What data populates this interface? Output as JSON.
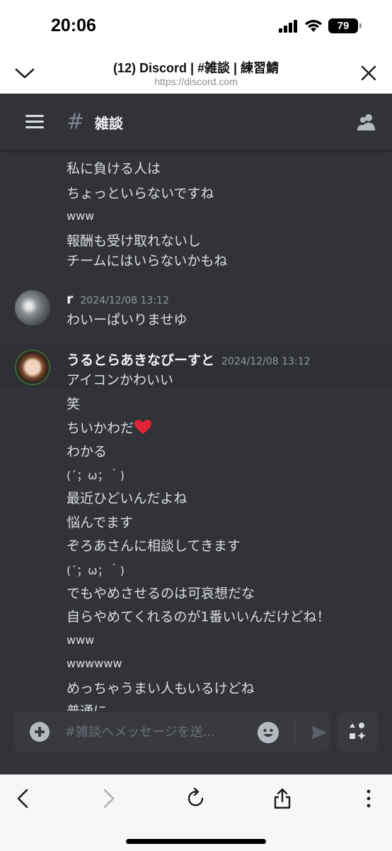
{
  "status_bar": {
    "time": "20:06",
    "battery": "79"
  },
  "sheet": {
    "title": "(12) Discord | #雑談 | 練習鯖",
    "url": "https://discord.com"
  },
  "channel": {
    "hash": "#",
    "name": "雑談"
  },
  "messages": {
    "continuation_top": [
      "私に負ける人は",
      "ちょっといらないですね",
      "www",
      "報酬も受け取れないし",
      "チームにはいらないかもね"
    ],
    "group_r": {
      "username": "r",
      "timestamp": "2024/12/08 13:12",
      "lines": [
        "わいーぱいりませゆ"
      ]
    },
    "group_uru": {
      "username": "うるとらあきなびーすと",
      "timestamp": "2024/12/08 13:12",
      "lines": [
        "アイコンかわいい",
        "笑",
        "ちいかわだ",
        "わかる",
        "(´；ω；｀)",
        "最近ひどいんだよね",
        "悩んでます",
        "ぞろあさんに相談してきます",
        "(´；ω；｀)",
        "でもやめさせるのは可哀想だな",
        "自らやめてくれるのが1番いいんだけどね！",
        "www",
        "wwwwww",
        "めっちゃうまい人もいるけどね",
        "普通に"
      ],
      "heart_emoji": "❤️"
    }
  },
  "composer": {
    "placeholder": "#雑談へメッセージを送..."
  },
  "icons": {
    "chevron": "chevron-down-icon",
    "close": "close-icon",
    "menu": "hamburger-menu-icon",
    "members": "members-icon",
    "add": "plus-circle-icon",
    "emoji": "emoji-icon",
    "send": "send-icon",
    "apps": "apps-icon",
    "back": "back-arrow-icon",
    "forward": "forward-arrow-icon",
    "reload": "reload-icon",
    "share": "share-icon",
    "more": "more-vertical-icon"
  },
  "colors": {
    "background": "#313338",
    "text": "#dbdee1",
    "muted": "#949ba4",
    "heart": "#e0243a"
  }
}
